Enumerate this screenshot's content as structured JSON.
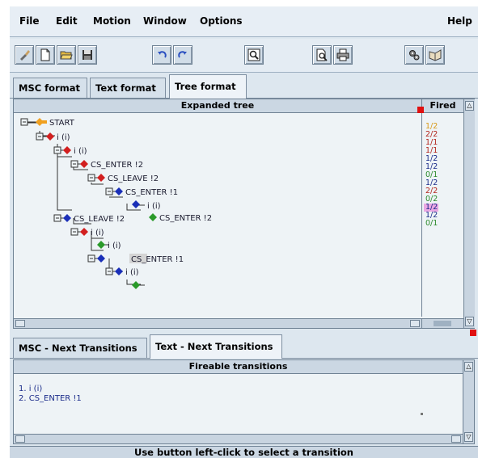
{
  "menu": [
    "File",
    "Edit",
    "Motion",
    "Window",
    "Options",
    "Help"
  ],
  "tabs_top": [
    "MSC format",
    "Text format",
    "Tree format"
  ],
  "tree_panel": {
    "header": "Expanded tree",
    "fired_header": "Fired",
    "nodes": [
      "START",
      "i (i)",
      "i (i)",
      "CS_ENTER !2",
      "CS_LEAVE !2",
      "CS_ENTER !1",
      "i (i)",
      "CS_ENTER !2",
      "CS_LEAVE !2",
      "i (i)",
      "i (i)",
      "CS_ENTER !1",
      "i (i)"
    ],
    "fired": [
      {
        "text": "1/2",
        "color": "#d89a1a"
      },
      {
        "text": "2/2",
        "color": "#b3261e"
      },
      {
        "text": "1/1",
        "color": "#b3261e"
      },
      {
        "text": "1/1",
        "color": "#b3261e"
      },
      {
        "text": "1/2",
        "color": "#1b2c8a"
      },
      {
        "text": "1/2",
        "color": "#1b2c8a"
      },
      {
        "text": "0/1",
        "color": "#2a8a2a"
      },
      {
        "text": "1/2",
        "color": "#1b2c8a"
      },
      {
        "text": "2/2",
        "color": "#b3261e"
      },
      {
        "text": "0/2",
        "color": "#2a8a2a"
      },
      {
        "text": "1/2",
        "color": "#1b2c8a"
      },
      {
        "text": "1/2",
        "color": "#1b2c8a"
      },
      {
        "text": "0/1",
        "color": "#2a8a2a"
      }
    ]
  },
  "tabs_bottom": [
    "MSC - Next Transitions",
    "Text - Next Transitions"
  ],
  "transitions_panel": {
    "header": "Fireable transitions",
    "items": [
      "1. i (i)",
      "2. CS_ENTER !1"
    ]
  },
  "status": "Use button left-click to select a transition",
  "colors": {
    "orange": "#f0a020",
    "red": "#d21f1f",
    "blue": "#1a2fb8",
    "green": "#2a9a2a",
    "highlight_fired": "#e9a7e3"
  }
}
